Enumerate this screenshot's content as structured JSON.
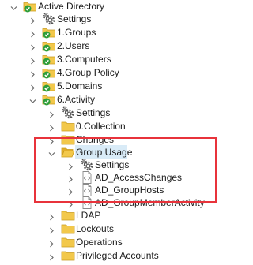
{
  "tree": {
    "root": {
      "label": "Active Directory",
      "icon": "folder-check-icon",
      "state": "expanded"
    },
    "nodes": [
      {
        "label": "Settings",
        "icon": "gears-icon",
        "state": "collapsed"
      },
      {
        "label": "1.Groups",
        "icon": "folder-check-icon",
        "state": "collapsed"
      },
      {
        "label": "2.Users",
        "icon": "folder-check-icon",
        "state": "collapsed"
      },
      {
        "label": "3.Computers",
        "icon": "folder-check-icon",
        "state": "collapsed"
      },
      {
        "label": "4.Group Policy",
        "icon": "folder-check-icon",
        "state": "collapsed"
      },
      {
        "label": "5.Domains",
        "icon": "folder-check-icon",
        "state": "collapsed"
      },
      {
        "label": "6.Activity",
        "icon": "folder-check-icon",
        "state": "expanded"
      },
      {
        "label": "Settings",
        "icon": "gears-icon",
        "state": "collapsed"
      },
      {
        "label": "0.Collection",
        "icon": "folder-icon",
        "state": "collapsed"
      },
      {
        "label": "Changes",
        "icon": "folder-icon",
        "state": "collapsed"
      },
      {
        "label": "Group Usage",
        "icon": "folder-open-icon",
        "state": "expanded",
        "selected": true
      },
      {
        "label": "Settings",
        "icon": "gears-icon",
        "state": "collapsed"
      },
      {
        "label": "AD_AccessChanges",
        "icon": "report-icon",
        "state": "collapsed"
      },
      {
        "label": "AD_GroupHosts",
        "icon": "report-icon",
        "state": "collapsed"
      },
      {
        "label": "AD_GroupMemberActivity",
        "icon": "report-icon",
        "state": "collapsed"
      },
      {
        "label": "LDAP",
        "icon": "folder-icon",
        "state": "collapsed"
      },
      {
        "label": "Lockouts",
        "icon": "folder-icon",
        "state": "collapsed"
      },
      {
        "label": "Operations",
        "icon": "folder-icon",
        "state": "collapsed"
      },
      {
        "label": "Privileged Accounts",
        "icon": "folder-icon",
        "state": "collapsed"
      }
    ]
  },
  "colors": {
    "folder": "#f2c84b",
    "check": "#2f9e3a",
    "highlight_border": "#e8333b",
    "selection": "#d9ebf7",
    "chevron": "#6b6b6b"
  }
}
